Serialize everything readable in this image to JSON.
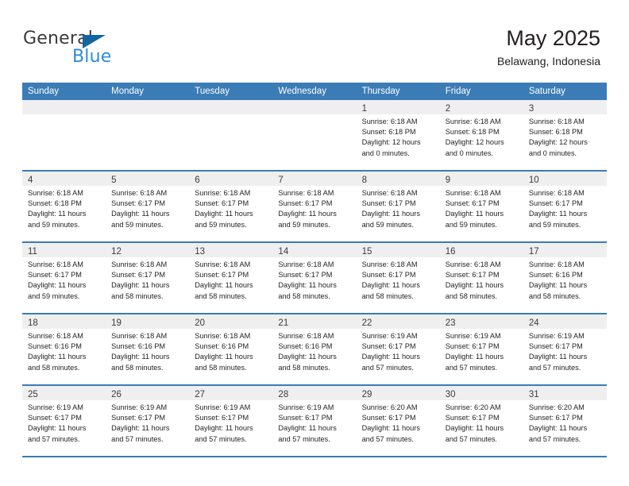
{
  "brand": {
    "name_part1": "General",
    "name_part2": "Blue",
    "triangle_color": "#1464a0",
    "blue_color": "#2e8bd6"
  },
  "header": {
    "title": "May 2025",
    "subtitle": "Belawang, Indonesia"
  },
  "theme": {
    "header_bg": "#3b7cb7",
    "daynum_bg": "#efefef",
    "text": "#231f20"
  },
  "weekdays": [
    "Sunday",
    "Monday",
    "Tuesday",
    "Wednesday",
    "Thursday",
    "Friday",
    "Saturday"
  ],
  "labels": {
    "sunrise_prefix": "Sunrise: ",
    "sunset_prefix": "Sunset: ",
    "daylight_prefix": "Daylight: "
  },
  "weeks": [
    [
      {
        "day": ""
      },
      {
        "day": ""
      },
      {
        "day": ""
      },
      {
        "day": ""
      },
      {
        "day": "1",
        "sunrise": "Sunrise: 6:18 AM",
        "sunset": "Sunset: 6:18 PM",
        "daylight_line1": "Daylight: 12 hours",
        "daylight_line2": "and 0 minutes."
      },
      {
        "day": "2",
        "sunrise": "Sunrise: 6:18 AM",
        "sunset": "Sunset: 6:18 PM",
        "daylight_line1": "Daylight: 12 hours",
        "daylight_line2": "and 0 minutes."
      },
      {
        "day": "3",
        "sunrise": "Sunrise: 6:18 AM",
        "sunset": "Sunset: 6:18 PM",
        "daylight_line1": "Daylight: 12 hours",
        "daylight_line2": "and 0 minutes."
      }
    ],
    [
      {
        "day": "4",
        "sunrise": "Sunrise: 6:18 AM",
        "sunset": "Sunset: 6:18 PM",
        "daylight_line1": "Daylight: 11 hours",
        "daylight_line2": "and 59 minutes."
      },
      {
        "day": "5",
        "sunrise": "Sunrise: 6:18 AM",
        "sunset": "Sunset: 6:17 PM",
        "daylight_line1": "Daylight: 11 hours",
        "daylight_line2": "and 59 minutes."
      },
      {
        "day": "6",
        "sunrise": "Sunrise: 6:18 AM",
        "sunset": "Sunset: 6:17 PM",
        "daylight_line1": "Daylight: 11 hours",
        "daylight_line2": "and 59 minutes."
      },
      {
        "day": "7",
        "sunrise": "Sunrise: 6:18 AM",
        "sunset": "Sunset: 6:17 PM",
        "daylight_line1": "Daylight: 11 hours",
        "daylight_line2": "and 59 minutes."
      },
      {
        "day": "8",
        "sunrise": "Sunrise: 6:18 AM",
        "sunset": "Sunset: 6:17 PM",
        "daylight_line1": "Daylight: 11 hours",
        "daylight_line2": "and 59 minutes."
      },
      {
        "day": "9",
        "sunrise": "Sunrise: 6:18 AM",
        "sunset": "Sunset: 6:17 PM",
        "daylight_line1": "Daylight: 11 hours",
        "daylight_line2": "and 59 minutes."
      },
      {
        "day": "10",
        "sunrise": "Sunrise: 6:18 AM",
        "sunset": "Sunset: 6:17 PM",
        "daylight_line1": "Daylight: 11 hours",
        "daylight_line2": "and 59 minutes."
      }
    ],
    [
      {
        "day": "11",
        "sunrise": "Sunrise: 6:18 AM",
        "sunset": "Sunset: 6:17 PM",
        "daylight_line1": "Daylight: 11 hours",
        "daylight_line2": "and 59 minutes."
      },
      {
        "day": "12",
        "sunrise": "Sunrise: 6:18 AM",
        "sunset": "Sunset: 6:17 PM",
        "daylight_line1": "Daylight: 11 hours",
        "daylight_line2": "and 58 minutes."
      },
      {
        "day": "13",
        "sunrise": "Sunrise: 6:18 AM",
        "sunset": "Sunset: 6:17 PM",
        "daylight_line1": "Daylight: 11 hours",
        "daylight_line2": "and 58 minutes."
      },
      {
        "day": "14",
        "sunrise": "Sunrise: 6:18 AM",
        "sunset": "Sunset: 6:17 PM",
        "daylight_line1": "Daylight: 11 hours",
        "daylight_line2": "and 58 minutes."
      },
      {
        "day": "15",
        "sunrise": "Sunrise: 6:18 AM",
        "sunset": "Sunset: 6:17 PM",
        "daylight_line1": "Daylight: 11 hours",
        "daylight_line2": "and 58 minutes."
      },
      {
        "day": "16",
        "sunrise": "Sunrise: 6:18 AM",
        "sunset": "Sunset: 6:17 PM",
        "daylight_line1": "Daylight: 11 hours",
        "daylight_line2": "and 58 minutes."
      },
      {
        "day": "17",
        "sunrise": "Sunrise: 6:18 AM",
        "sunset": "Sunset: 6:16 PM",
        "daylight_line1": "Daylight: 11 hours",
        "daylight_line2": "and 58 minutes."
      }
    ],
    [
      {
        "day": "18",
        "sunrise": "Sunrise: 6:18 AM",
        "sunset": "Sunset: 6:16 PM",
        "daylight_line1": "Daylight: 11 hours",
        "daylight_line2": "and 58 minutes."
      },
      {
        "day": "19",
        "sunrise": "Sunrise: 6:18 AM",
        "sunset": "Sunset: 6:16 PM",
        "daylight_line1": "Daylight: 11 hours",
        "daylight_line2": "and 58 minutes."
      },
      {
        "day": "20",
        "sunrise": "Sunrise: 6:18 AM",
        "sunset": "Sunset: 6:16 PM",
        "daylight_line1": "Daylight: 11 hours",
        "daylight_line2": "and 58 minutes."
      },
      {
        "day": "21",
        "sunrise": "Sunrise: 6:18 AM",
        "sunset": "Sunset: 6:16 PM",
        "daylight_line1": "Daylight: 11 hours",
        "daylight_line2": "and 58 minutes."
      },
      {
        "day": "22",
        "sunrise": "Sunrise: 6:19 AM",
        "sunset": "Sunset: 6:17 PM",
        "daylight_line1": "Daylight: 11 hours",
        "daylight_line2": "and 57 minutes."
      },
      {
        "day": "23",
        "sunrise": "Sunrise: 6:19 AM",
        "sunset": "Sunset: 6:17 PM",
        "daylight_line1": "Daylight: 11 hours",
        "daylight_line2": "and 57 minutes."
      },
      {
        "day": "24",
        "sunrise": "Sunrise: 6:19 AM",
        "sunset": "Sunset: 6:17 PM",
        "daylight_line1": "Daylight: 11 hours",
        "daylight_line2": "and 57 minutes."
      }
    ],
    [
      {
        "day": "25",
        "sunrise": "Sunrise: 6:19 AM",
        "sunset": "Sunset: 6:17 PM",
        "daylight_line1": "Daylight: 11 hours",
        "daylight_line2": "and 57 minutes."
      },
      {
        "day": "26",
        "sunrise": "Sunrise: 6:19 AM",
        "sunset": "Sunset: 6:17 PM",
        "daylight_line1": "Daylight: 11 hours",
        "daylight_line2": "and 57 minutes."
      },
      {
        "day": "27",
        "sunrise": "Sunrise: 6:19 AM",
        "sunset": "Sunset: 6:17 PM",
        "daylight_line1": "Daylight: 11 hours",
        "daylight_line2": "and 57 minutes."
      },
      {
        "day": "28",
        "sunrise": "Sunrise: 6:19 AM",
        "sunset": "Sunset: 6:17 PM",
        "daylight_line1": "Daylight: 11 hours",
        "daylight_line2": "and 57 minutes."
      },
      {
        "day": "29",
        "sunrise": "Sunrise: 6:20 AM",
        "sunset": "Sunset: 6:17 PM",
        "daylight_line1": "Daylight: 11 hours",
        "daylight_line2": "and 57 minutes."
      },
      {
        "day": "30",
        "sunrise": "Sunrise: 6:20 AM",
        "sunset": "Sunset: 6:17 PM",
        "daylight_line1": "Daylight: 11 hours",
        "daylight_line2": "and 57 minutes."
      },
      {
        "day": "31",
        "sunrise": "Sunrise: 6:20 AM",
        "sunset": "Sunset: 6:17 PM",
        "daylight_line1": "Daylight: 11 hours",
        "daylight_line2": "and 57 minutes."
      }
    ]
  ]
}
